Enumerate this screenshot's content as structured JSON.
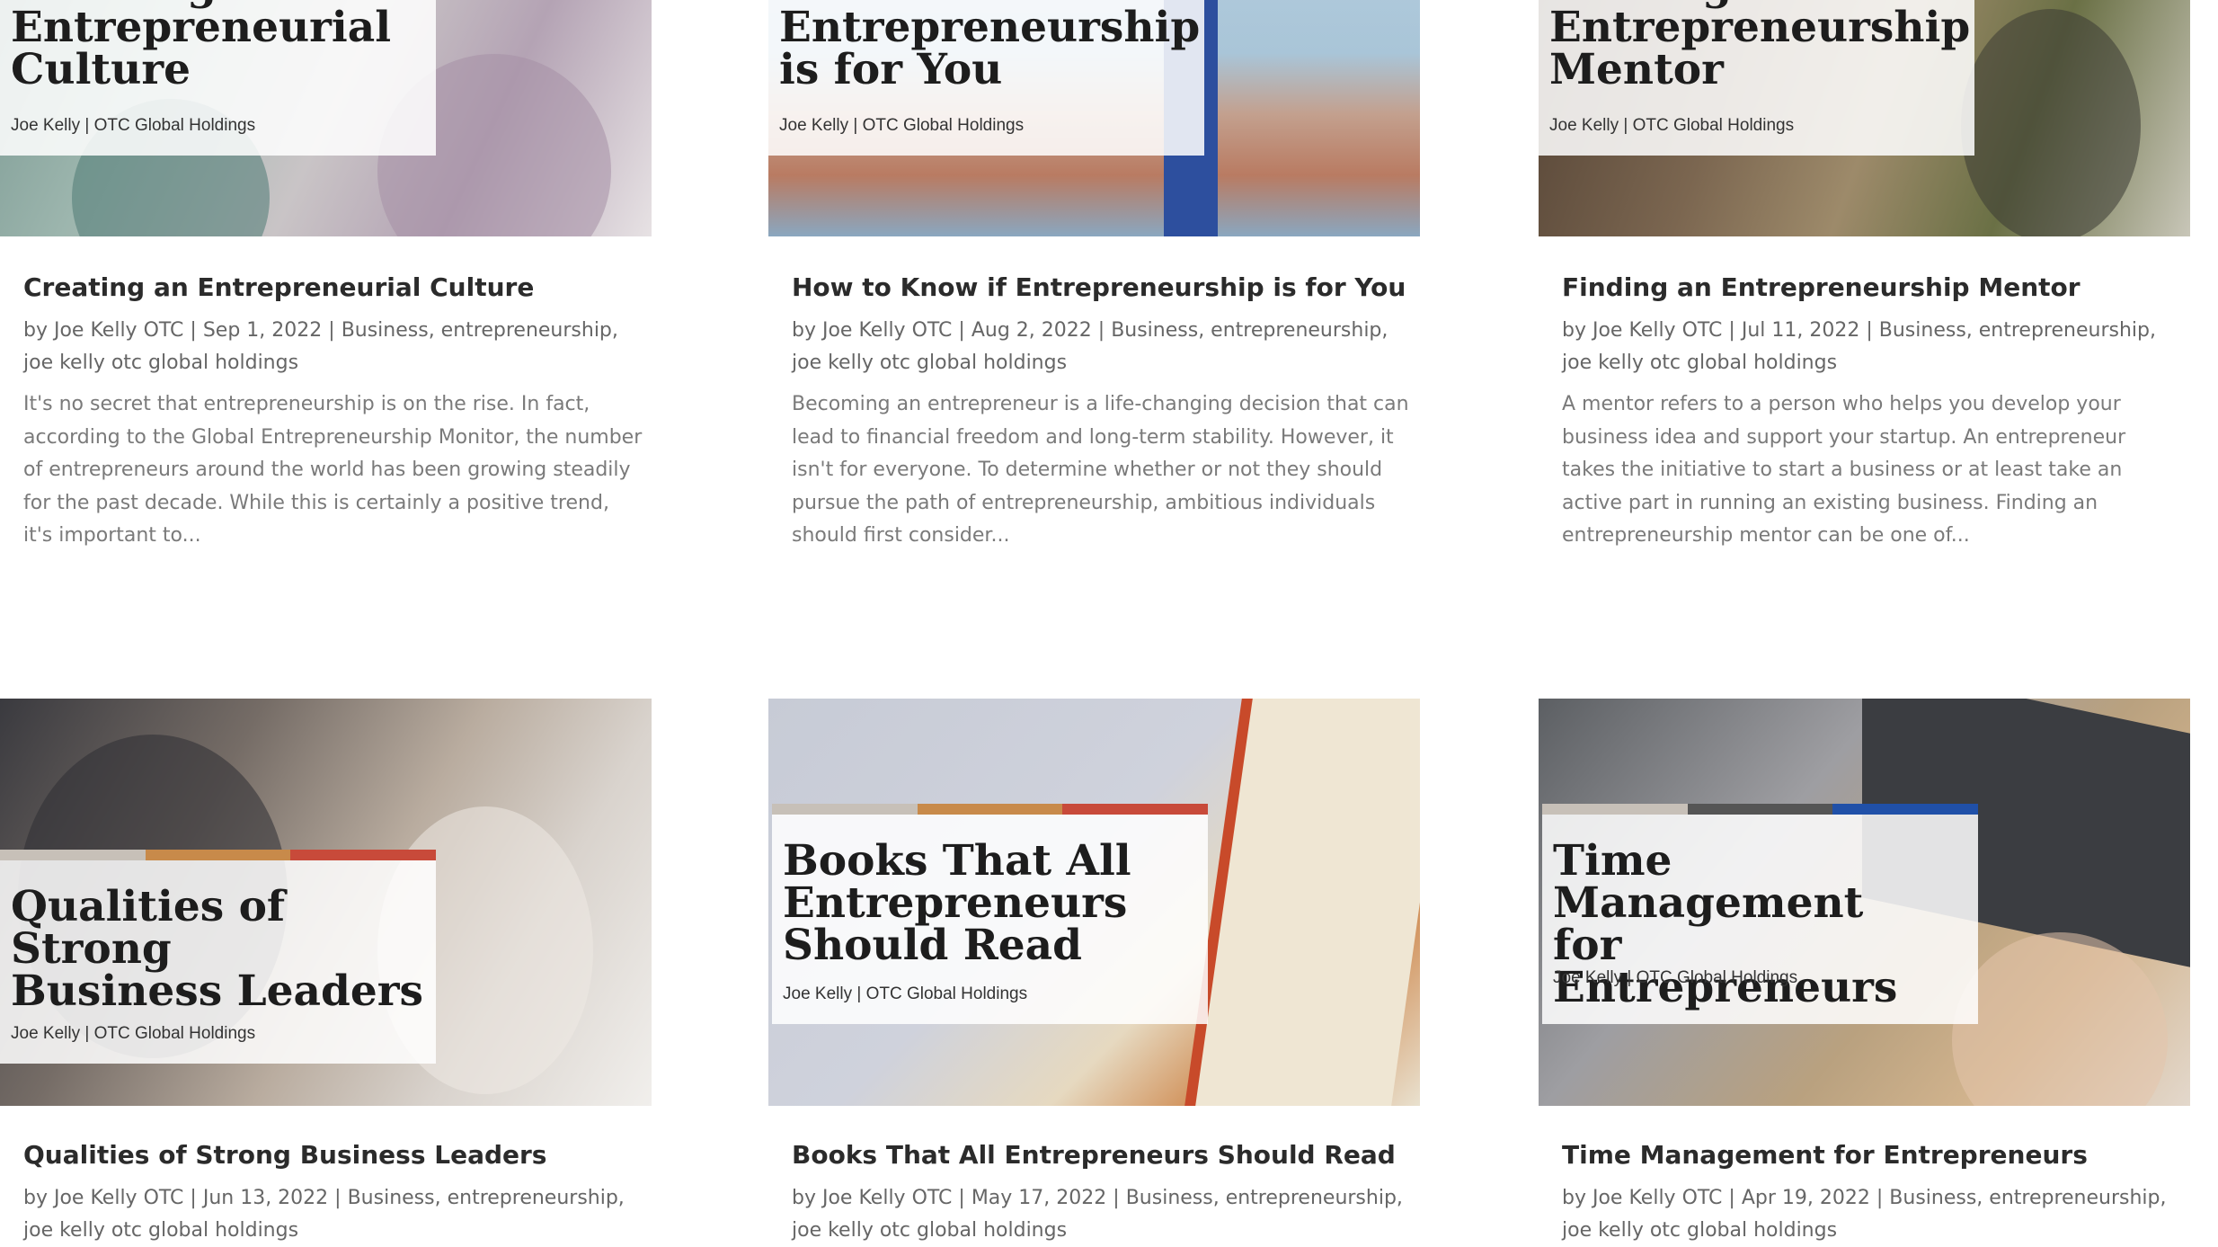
{
  "posts": [
    {
      "title": "Creating an Entrepreneurial Culture",
      "image_title": "Creating an\nEntrepreneurial\nCulture",
      "image_byline": "Joe Kelly | OTC Global Holdings",
      "author": "Joe Kelly OTC",
      "date": "Sep 1, 2022",
      "categories": "Business, entrepreneurship, joe kelly otc global holdings",
      "excerpt": "It's no secret that entrepreneurship is on the rise. In fact, according to the Global Entrepreneurship Monitor, the number of entrepreneurs around the world has been growing steadily for the past decade. While this is certainly a positive trend, it's important to..."
    },
    {
      "title": "How to Know if Entrepreneurship is for You",
      "image_title": "How to Know if\nEntrepreneurship\nis for You",
      "image_byline": "Joe Kelly | OTC Global Holdings",
      "author": "Joe Kelly OTC",
      "date": "Aug 2, 2022",
      "categories": "Business, entrepreneurship, joe kelly otc global holdings",
      "excerpt": "Becoming an entrepreneur is a life-changing decision that can lead to financial freedom and long-term stability. However, it isn't for everyone. To determine whether or not they should pursue the path of entrepreneurship, ambitious individuals should first consider..."
    },
    {
      "title": "Finding an Entrepreneurship Mentor",
      "image_title": "Finding an\nEntrepreneurship\nMentor",
      "image_byline": "Joe Kelly | OTC Global Holdings",
      "author": "Joe Kelly OTC",
      "date": "Jul 11, 2022",
      "categories": "Business, entrepreneurship, joe kelly otc global holdings",
      "excerpt": "A mentor refers to a person who helps you develop your business idea and support your startup. An entrepreneur takes the initiative to start a business or at least take an active part in running an existing business. Finding an entrepreneurship mentor can be one of..."
    },
    {
      "title": "Qualities of Strong Business Leaders",
      "image_title": "Qualities of Strong\nBusiness Leaders",
      "image_byline": "Joe Kelly | OTC Global Holdings",
      "author": "Joe Kelly OTC",
      "date": "Jun 13, 2022",
      "categories": "Business, entrepreneurship, joe kelly otc global holdings",
      "excerpt": ""
    },
    {
      "title": "Books That All Entrepreneurs Should Read",
      "image_title": "Books That All\nEntrepreneurs\nShould Read",
      "image_byline": "Joe Kelly | OTC Global Holdings",
      "author": "Joe Kelly OTC",
      "date": "May 17, 2022",
      "categories": "Business, entrepreneurship, joe kelly otc global holdings",
      "excerpt": ""
    },
    {
      "title": "Time Management for Entrepreneurs",
      "image_title": "Time Management\nfor Entrepreneurs",
      "image_byline": "Joe Kelly | OTC Global Holdings",
      "author": "Joe Kelly OTC",
      "date": "Apr 19, 2022",
      "categories": "Business, entrepreneurship, joe kelly otc global holdings",
      "excerpt": ""
    }
  ],
  "meta": {
    "by": "by",
    "separator": "|"
  },
  "colors": {
    "title": "#2b2b2b",
    "meta": "#666666",
    "excerpt": "#7a7a7a",
    "stripe_1": "#c7c0b8",
    "stripe_2": "#c88a4a",
    "stripe_3": "#c84a3a",
    "stripe_blue": "#2050a8"
  }
}
